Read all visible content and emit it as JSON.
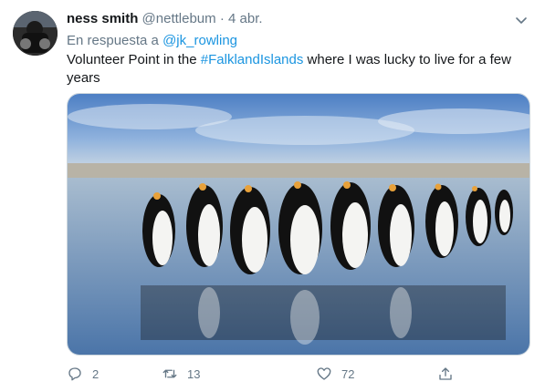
{
  "author": {
    "name": "ness smith",
    "handle": "@nettlebum",
    "separator": "·",
    "date": "4 abr."
  },
  "reply": {
    "prefix": "En respuesta a",
    "mention": "@jk_rowling"
  },
  "body": {
    "text_before": "Volunteer Point in the ",
    "hashtag": "#FalklandIslands",
    "text_after": " where I was lucky to live for a few years"
  },
  "actions": {
    "replies": "2",
    "retweets": "13",
    "likes": "72"
  },
  "colors": {
    "link": "#1b95e0",
    "muted": "#657786",
    "text": "#14171a"
  },
  "icons": [
    "caret-down-icon",
    "reply-icon",
    "retweet-icon",
    "like-icon",
    "share-icon"
  ]
}
